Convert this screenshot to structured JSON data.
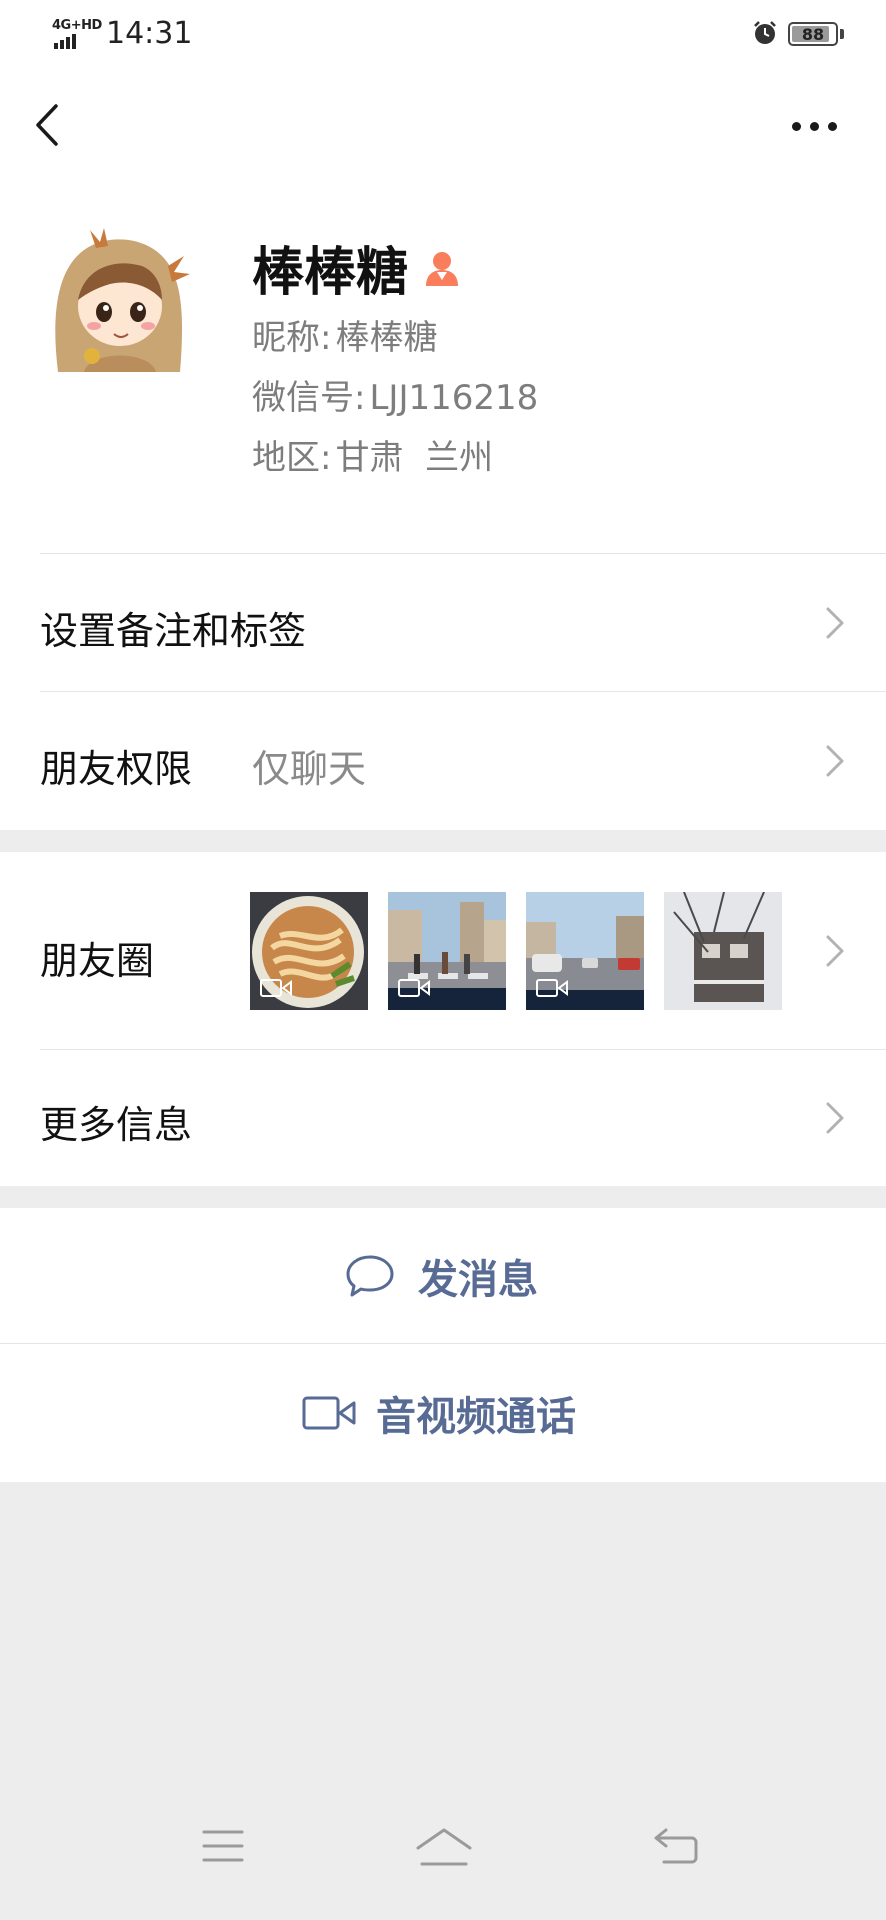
{
  "status_bar": {
    "network": "4G+HD",
    "time": "14:31",
    "battery": "88",
    "battery_level": 0.88,
    "icons": [
      "signal-icon",
      "alarm-icon",
      "battery-icon"
    ]
  },
  "nav": {
    "icons": [
      "back-arrow-icon",
      "more-dots-icon"
    ]
  },
  "profile": {
    "name": "棒棒糖",
    "nickname_label": "昵称:",
    "nickname": "棒棒糖",
    "wechat_id_label": "微信号:",
    "wechat_id": "LJJ116218",
    "region_label": "地区:",
    "region": "甘肃  兰州",
    "gender_icon": "female-icon",
    "gender_color": "#fa7d5c"
  },
  "rows": {
    "remark_label": "设置备注和标签",
    "permission_label": "朋友权限",
    "permission_value": "仅聊天",
    "moments_label": "朋友圈",
    "more_info_label": "更多信息"
  },
  "moments": {
    "thumbnails": [
      {
        "subject": "noodle bowl",
        "video": true
      },
      {
        "subject": "street crosswalk",
        "video": true
      },
      {
        "subject": "road traffic",
        "video": true
      },
      {
        "subject": "building and trees",
        "video": false
      }
    ]
  },
  "actions": {
    "message_label": "发消息",
    "call_label": "音视频通话",
    "accent_color": "#576b95"
  },
  "system_nav": {
    "icons": [
      "menu-icon",
      "home-icon",
      "back-icon"
    ]
  }
}
